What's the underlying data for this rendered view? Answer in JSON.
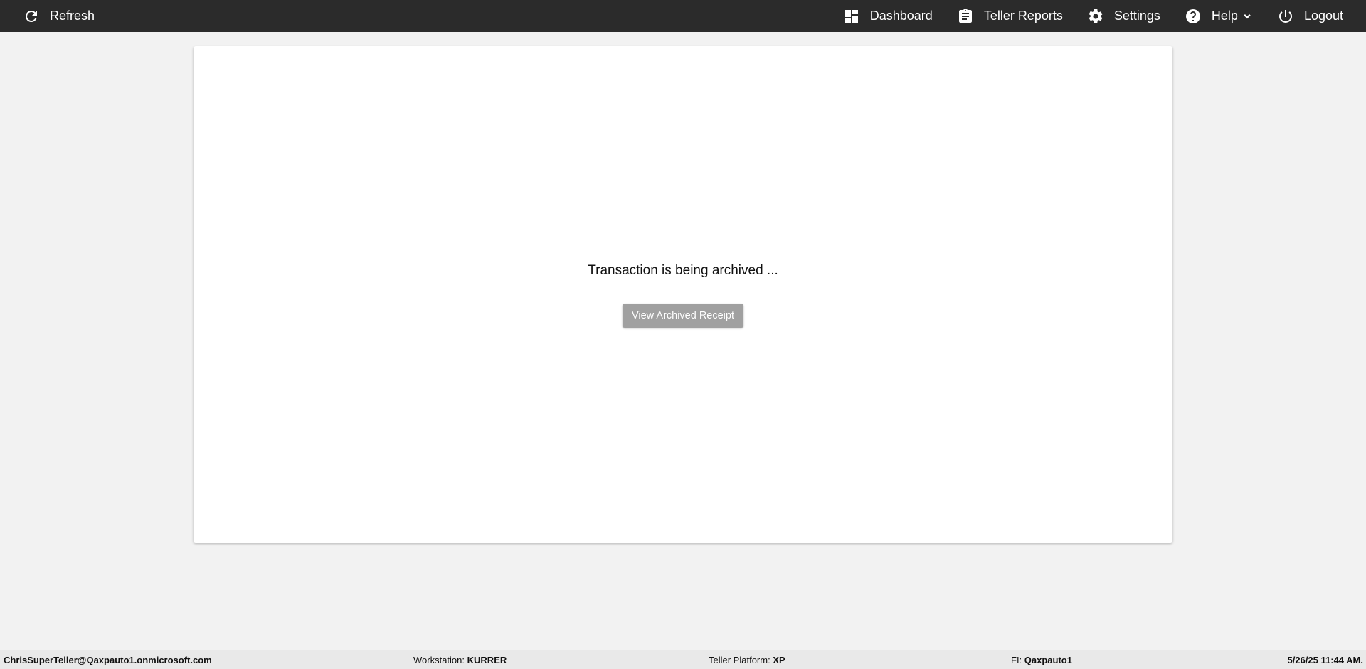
{
  "topbar": {
    "refresh_label": "Refresh",
    "nav": {
      "dashboard": "Dashboard",
      "teller_reports": "Teller Reports",
      "settings": "Settings",
      "help": "Help",
      "logout": "Logout"
    }
  },
  "main": {
    "message": "Transaction is being archived ...",
    "view_receipt_label": "View Archived Receipt"
  },
  "status": {
    "user": "ChrisSuperTeller@Qaxpauto1.onmicrosoft.com",
    "workstation_label": "Workstation:",
    "workstation": "KURRER",
    "platform_label": "Teller Platform:",
    "platform": "XP",
    "fi_label": "FI:",
    "fi": "Qaxpauto1",
    "datetime": "5/26/25 11:44 AM."
  },
  "colors": {
    "topbar_bg": "#2b2b2b",
    "page_bg": "#f2f2f2",
    "button_disabled": "#a0a0a0"
  }
}
